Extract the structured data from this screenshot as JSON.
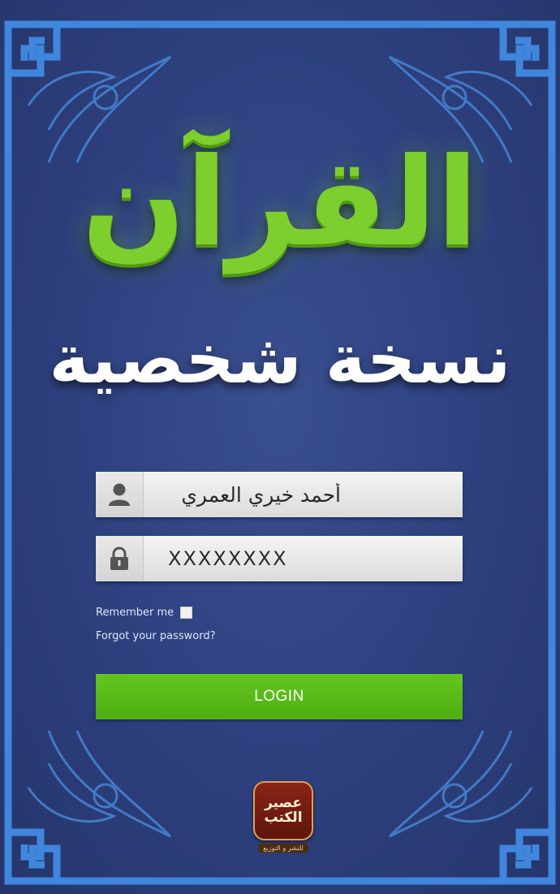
{
  "title": {
    "main": "القرآن",
    "sub": "نسخة شخصية"
  },
  "login_form": {
    "username_value": "أحمد خيري العمري",
    "password_value": "XXXXXXXX",
    "remember_label": "Remember me",
    "remember_checked": false,
    "forgot_label": "Forgot your password?",
    "login_label": "LOGIN"
  },
  "publisher": {
    "line1": "عصير",
    "line2": "الكتب",
    "tagline": "للنشر و التوزيع"
  },
  "icons": {
    "username": "user-icon",
    "password": "lock-icon"
  },
  "colors": {
    "background": "#2f4281",
    "frame": "#3d7fd6",
    "title_green": "#7ccf2c",
    "button_green": "#5bbb1a"
  }
}
